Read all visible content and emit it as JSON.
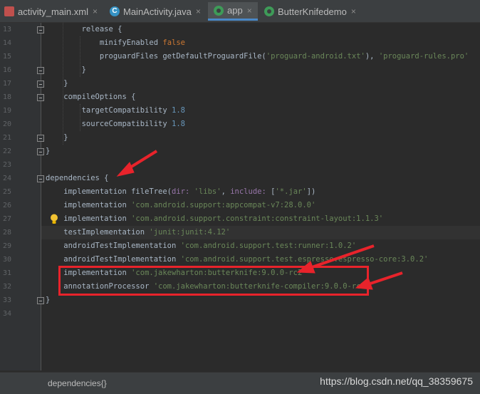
{
  "tabs": [
    {
      "label": "activity_main.xml",
      "icon": "xml-file-icon",
      "active": false
    },
    {
      "label": "MainActivity.java",
      "icon": "java-class-icon",
      "active": false
    },
    {
      "label": "app",
      "icon": "gradle-icon",
      "active": true
    },
    {
      "label": "ButterKnifedemo",
      "icon": "gradle-icon",
      "active": false
    }
  ],
  "close_glyph": "×",
  "java_icon_letter": "C",
  "line_numbers": [
    "13",
    "14",
    "15",
    "16",
    "17",
    "18",
    "19",
    "20",
    "21",
    "22",
    "23",
    "24",
    "25",
    "26",
    "27",
    "28",
    "29",
    "30",
    "31",
    "32",
    "33",
    "34"
  ],
  "code_lines": [
    [
      {
        "t": "        release {",
        "c": "plain"
      }
    ],
    [
      {
        "t": "            minifyEnabled ",
        "c": "plain"
      },
      {
        "t": "false",
        "c": "kw"
      }
    ],
    [
      {
        "t": "            proguardFiles getDefaultProguardFile(",
        "c": "plain"
      },
      {
        "t": "'proguard-android.txt'",
        "c": "str"
      },
      {
        "t": "), ",
        "c": "plain"
      },
      {
        "t": "'proguard-rules.pro'",
        "c": "str"
      }
    ],
    [
      {
        "t": "        }",
        "c": "plain"
      }
    ],
    [
      {
        "t": "    }",
        "c": "plain"
      }
    ],
    [
      {
        "t": "    compileOptions {",
        "c": "plain"
      }
    ],
    [
      {
        "t": "        targetCompatibility ",
        "c": "plain"
      },
      {
        "t": "1.8",
        "c": "num"
      }
    ],
    [
      {
        "t": "        sourceCompatibility ",
        "c": "plain"
      },
      {
        "t": "1.8",
        "c": "num"
      }
    ],
    [
      {
        "t": "    }",
        "c": "plain"
      }
    ],
    [
      {
        "t": "}",
        "c": "plain"
      }
    ],
    [],
    [
      {
        "t": "dependencies {",
        "c": "plain"
      }
    ],
    [
      {
        "t": "    implementation fileTree(",
        "c": "plain"
      },
      {
        "t": "dir: ",
        "c": "named"
      },
      {
        "t": "'libs'",
        "c": "str"
      },
      {
        "t": ", ",
        "c": "plain"
      },
      {
        "t": "include: ",
        "c": "named"
      },
      {
        "t": "[",
        "c": "plain"
      },
      {
        "t": "'*.jar'",
        "c": "str"
      },
      {
        "t": "])",
        "c": "plain"
      }
    ],
    [
      {
        "t": "    implementation ",
        "c": "plain"
      },
      {
        "t": "'com.android.support:appcompat-v7:28.0.0'",
        "c": "str"
      }
    ],
    [
      {
        "t": "    implementation ",
        "c": "plain"
      },
      {
        "t": "'com.android.support.constraint:constraint-layout:1.1.3'",
        "c": "str"
      }
    ],
    [
      {
        "t": "    testImplementation ",
        "c": "plain"
      },
      {
        "t": "'junit:junit:4.12'",
        "c": "str"
      }
    ],
    [
      {
        "t": "    androidTestImplementation ",
        "c": "plain"
      },
      {
        "t": "'com.android.support.test:runner:1.0.2'",
        "c": "str"
      }
    ],
    [
      {
        "t": "    androidTestImplementation ",
        "c": "plain"
      },
      {
        "t": "'com.android.support.test.espresso:espresso-core:3.0.2'",
        "c": "str"
      }
    ],
    [
      {
        "t": "    implementation ",
        "c": "plain"
      },
      {
        "t": "'com.jakewharton:butterknife:9.0.0-rc2'",
        "c": "str"
      }
    ],
    [
      {
        "t": "    annotationProcessor ",
        "c": "plain"
      },
      {
        "t": "'com.jakewharton:butterknife-compiler:9.0.0-rc2'",
        "c": "str"
      }
    ],
    [
      {
        "t": "}",
        "c": "plain"
      }
    ],
    []
  ],
  "highlighted_line_number": "28",
  "breadcrumb": "dependencies{}",
  "watermark": "https://blog.csdn.net/qq_38359675",
  "colors": {
    "background": "#2b2b2b",
    "keyword": "#cc7832",
    "string": "#6a8759",
    "number": "#6897bb",
    "named_arg": "#9876aa",
    "annotation_red": "#e8232b"
  }
}
